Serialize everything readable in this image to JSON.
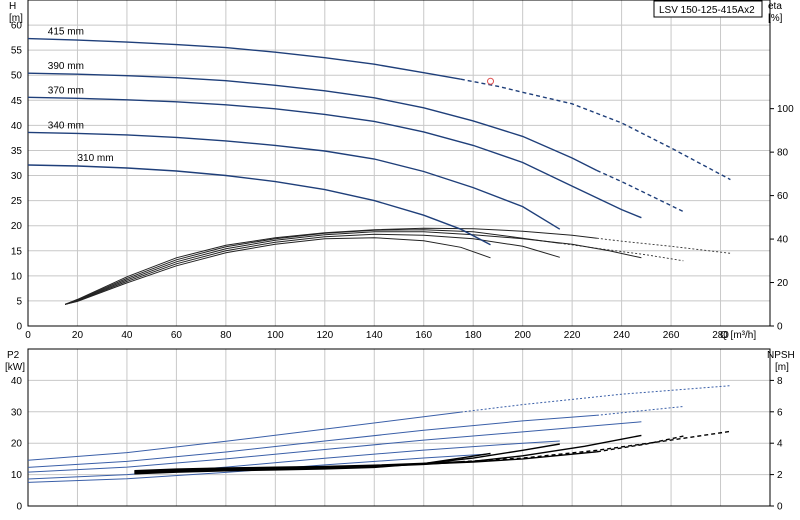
{
  "model": "LSV 150-125-415Ax2",
  "chart_data": [
    {
      "type": "line",
      "x_label": "Q [m³/h]",
      "y_label_left_1": "H",
      "y_label_left_2": "[m]",
      "y_label_right_1": "eta",
      "y_label_right_2": "[%]",
      "xlim": [
        0,
        300
      ],
      "ylim_left": [
        0,
        65
      ],
      "ylim_right": [
        0,
        150
      ],
      "x_ticks": [
        0,
        20,
        40,
        60,
        80,
        100,
        120,
        140,
        160,
        180,
        200,
        220,
        240,
        260,
        280
      ],
      "y_ticks_left": [
        0,
        5,
        10,
        15,
        20,
        25,
        30,
        35,
        40,
        45,
        50,
        55,
        60
      ],
      "y_ticks_right": [
        0,
        20,
        40,
        60,
        80,
        100
      ],
      "x_tick_labels": [
        "0",
        "20",
        "40",
        "60",
        "80",
        "100",
        "120",
        "140",
        "160",
        "180",
        "200",
        "220",
        "240",
        "260",
        "280"
      ],
      "y_tick_labels_left": [
        "0",
        "5",
        "10",
        "15",
        "20",
        "25",
        "30",
        "35",
        "40",
        "45",
        "50",
        "55",
        "60"
      ],
      "y_tick_labels_right": [
        "0",
        "20",
        "40",
        "60",
        "80",
        "100"
      ],
      "duty_point": {
        "q": 187,
        "h": 48.8
      },
      "head_curves": [
        {
          "name": "415 mm",
          "solid": [
            [
              0,
              57.3
            ],
            [
              20,
              57.0
            ],
            [
              40,
              56.6
            ],
            [
              60,
              56.1
            ],
            [
              80,
              55.5
            ],
            [
              100,
              54.6
            ],
            [
              120,
              53.5
            ],
            [
              140,
              52.2
            ],
            [
              160,
              50.5
            ],
            [
              175,
              49.2
            ]
          ],
          "dashed": [
            [
              175,
              49.2
            ],
            [
              190,
              47.8
            ],
            [
              200,
              46.6
            ],
            [
              220,
              44.3
            ],
            [
              240,
              40.5
            ],
            [
              260,
              35.5
            ],
            [
              284,
              29.2
            ]
          ]
        },
        {
          "name": "390 mm",
          "solid": [
            [
              0,
              50.4
            ],
            [
              20,
              50.2
            ],
            [
              40,
              49.9
            ],
            [
              60,
              49.5
            ],
            [
              80,
              48.9
            ],
            [
              100,
              48.0
            ],
            [
              120,
              46.9
            ],
            [
              140,
              45.5
            ],
            [
              160,
              43.5
            ],
            [
              180,
              40.9
            ],
            [
              200,
              37.8
            ],
            [
              220,
              33.5
            ],
            [
              230,
              31.0
            ]
          ],
          "dashed": [
            [
              230,
              31.0
            ],
            [
              240,
              28.8
            ],
            [
              255,
              25.2
            ],
            [
              265,
              22.8
            ]
          ]
        },
        {
          "name": "370 mm",
          "solid": [
            [
              0,
              45.6
            ],
            [
              20,
              45.4
            ],
            [
              40,
              45.1
            ],
            [
              60,
              44.7
            ],
            [
              80,
              44.1
            ],
            [
              100,
              43.3
            ],
            [
              120,
              42.2
            ],
            [
              140,
              40.8
            ],
            [
              160,
              38.7
            ],
            [
              180,
              36.0
            ],
            [
              200,
              32.6
            ],
            [
              220,
              27.9
            ],
            [
              240,
              23.2
            ],
            [
              248,
              21.6
            ]
          ],
          "dashed": []
        },
        {
          "name": "340 mm",
          "solid": [
            [
              0,
              38.6
            ],
            [
              20,
              38.4
            ],
            [
              40,
              38.1
            ],
            [
              60,
              37.6
            ],
            [
              80,
              36.9
            ],
            [
              100,
              36.0
            ],
            [
              120,
              34.9
            ],
            [
              140,
              33.3
            ],
            [
              160,
              30.8
            ],
            [
              180,
              27.6
            ],
            [
              200,
              23.8
            ],
            [
              215,
              19.3
            ]
          ],
          "dashed": []
        },
        {
          "name": "310 mm",
          "solid": [
            [
              0,
              32.1
            ],
            [
              20,
              31.9
            ],
            [
              40,
              31.5
            ],
            [
              60,
              30.9
            ],
            [
              80,
              30.0
            ],
            [
              100,
              28.8
            ],
            [
              120,
              27.2
            ],
            [
              140,
              25.0
            ],
            [
              160,
              22.1
            ],
            [
              175,
              19.3
            ],
            [
              187,
              16.2
            ]
          ],
          "dashed": []
        }
      ],
      "eta_curves": [
        {
          "solid": [
            [
              15,
              4.3
            ],
            [
              20,
              5.3
            ],
            [
              40,
              9.8
            ],
            [
              60,
              13.6
            ],
            [
              80,
              16.1
            ],
            [
              100,
              17.6
            ],
            [
              120,
              18.6
            ],
            [
              140,
              19.2
            ],
            [
              160,
              19.5
            ],
            [
              180,
              19.4
            ],
            [
              200,
              18.9
            ],
            [
              220,
              18.1
            ],
            [
              230,
              17.5
            ]
          ],
          "dashed": [
            [
              230,
              17.5
            ],
            [
              240,
              16.9
            ],
            [
              260,
              15.9
            ],
            [
              284,
              14.5
            ]
          ]
        },
        {
          "solid": [
            [
              15,
              4.3
            ],
            [
              20,
              5.2
            ],
            [
              40,
              9.5
            ],
            [
              60,
              13.2
            ],
            [
              80,
              15.8
            ],
            [
              100,
              17.4
            ],
            [
              120,
              18.5
            ],
            [
              140,
              19.1
            ],
            [
              160,
              19.2
            ],
            [
              180,
              18.8
            ],
            [
              200,
              17.5
            ],
            [
              215,
              16.5
            ]
          ],
          "dashed": [
            [
              215,
              16.5
            ],
            [
              230,
              15.5
            ],
            [
              250,
              14.2
            ],
            [
              265,
              13.0
            ]
          ]
        },
        {
          "solid": [
            [
              15,
              4.3
            ],
            [
              20,
              5.1
            ],
            [
              40,
              9.2
            ],
            [
              60,
              12.8
            ],
            [
              80,
              15.4
            ],
            [
              100,
              17.1
            ],
            [
              120,
              18.2
            ],
            [
              140,
              18.8
            ],
            [
              160,
              18.8
            ],
            [
              180,
              18.2
            ],
            [
              200,
              17.4
            ],
            [
              220,
              16.3
            ],
            [
              235,
              15.0
            ],
            [
              248,
              13.6
            ]
          ],
          "dashed": []
        },
        {
          "solid": [
            [
              15,
              4.3
            ],
            [
              20,
              5.0
            ],
            [
              40,
              8.9
            ],
            [
              60,
              12.4
            ],
            [
              80,
              15.0
            ],
            [
              100,
              16.7
            ],
            [
              120,
              17.8
            ],
            [
              140,
              18.3
            ],
            [
              160,
              18.1
            ],
            [
              180,
              17.4
            ],
            [
              200,
              15.9
            ],
            [
              215,
              13.7
            ]
          ],
          "dashed": []
        },
        {
          "solid": [
            [
              15,
              4.3
            ],
            [
              20,
              4.9
            ],
            [
              40,
              8.6
            ],
            [
              60,
              12.0
            ],
            [
              80,
              14.6
            ],
            [
              100,
              16.3
            ],
            [
              120,
              17.4
            ],
            [
              140,
              17.6
            ],
            [
              160,
              17.0
            ],
            [
              175,
              15.7
            ],
            [
              187,
              13.6
            ]
          ],
          "dashed": []
        }
      ]
    },
    {
      "type": "line",
      "y_label_left_1": "P2",
      "y_label_left_2": "[kW]",
      "y_label_right_1": "NPSH",
      "y_label_right_2": "[m]",
      "xlim": [
        0,
        300
      ],
      "ylim_left": [
        0,
        50
      ],
      "ylim_right": [
        0,
        10
      ],
      "y_ticks_left": [
        0,
        10,
        20,
        30,
        40
      ],
      "y_ticks_right": [
        0,
        2,
        4,
        6,
        8
      ],
      "y_tick_labels_left": [
        "0",
        "10",
        "20",
        "30",
        "40"
      ],
      "y_tick_labels_right": [
        "0",
        "2",
        "4",
        "6",
        "8"
      ],
      "power_curves": [
        {
          "solid": [
            [
              0,
              14.6
            ],
            [
              40,
              17.0
            ],
            [
              80,
              20.6
            ],
            [
              120,
              24.5
            ],
            [
              160,
              28.4
            ],
            [
              175,
              29.9
            ]
          ],
          "dashed": [
            [
              175,
              29.9
            ],
            [
              200,
              32.3
            ],
            [
              240,
              35.6
            ],
            [
              284,
              38.3
            ]
          ]
        },
        {
          "solid": [
            [
              0,
              12.3
            ],
            [
              40,
              14.2
            ],
            [
              80,
              17.2
            ],
            [
              120,
              20.7
            ],
            [
              160,
              24.1
            ],
            [
              200,
              27.1
            ],
            [
              230,
              28.9
            ]
          ],
          "dashed": [
            [
              230,
              28.9
            ],
            [
              265,
              31.7
            ]
          ]
        },
        {
          "solid": [
            [
              0,
              10.8
            ],
            [
              40,
              12.4
            ],
            [
              80,
              15.0
            ],
            [
              120,
              18.0
            ],
            [
              160,
              21.0
            ],
            [
              200,
              23.6
            ],
            [
              248,
              26.8
            ]
          ],
          "dashed": []
        },
        {
          "solid": [
            [
              0,
              8.6
            ],
            [
              40,
              10.0
            ],
            [
              80,
              12.4
            ],
            [
              120,
              15.2
            ],
            [
              160,
              17.8
            ],
            [
              200,
              20.0
            ],
            [
              215,
              20.7
            ]
          ],
          "dashed": []
        },
        {
          "solid": [
            [
              0,
              7.5
            ],
            [
              40,
              8.7
            ],
            [
              80,
              10.7
            ],
            [
              120,
              13.1
            ],
            [
              160,
              15.3
            ],
            [
              187,
              16.6
            ]
          ],
          "dashed": []
        }
      ],
      "npsh_curves": [
        {
          "solid": [
            [
              43,
              2.25
            ],
            [
              60,
              2.35
            ],
            [
              80,
              2.42
            ],
            [
              100,
              2.47
            ],
            [
              120,
              2.52
            ],
            [
              140,
              2.6
            ],
            [
              160,
              2.72
            ],
            [
              175,
              2.82
            ]
          ],
          "dashed": [
            [
              175,
              2.82
            ],
            [
              200,
              3.05
            ],
            [
              230,
              3.55
            ],
            [
              260,
              4.2
            ],
            [
              284,
              4.75
            ]
          ]
        },
        {
          "solid": [
            [
              43,
              2.2
            ],
            [
              60,
              2.3
            ],
            [
              80,
              2.38
            ],
            [
              100,
              2.43
            ],
            [
              120,
              2.48
            ],
            [
              140,
              2.55
            ],
            [
              160,
              2.67
            ],
            [
              180,
              2.8
            ],
            [
              200,
              3.0
            ],
            [
              230,
              3.45
            ]
          ],
          "dashed": [
            [
              230,
              3.45
            ],
            [
              250,
              3.95
            ],
            [
              265,
              4.45
            ]
          ]
        },
        {
          "solid": [
            [
              43,
              2.15
            ],
            [
              60,
              2.25
            ],
            [
              80,
              2.33
            ],
            [
              100,
              2.38
            ],
            [
              120,
              2.44
            ],
            [
              140,
              2.52
            ],
            [
              160,
              2.65
            ],
            [
              180,
              2.85
            ],
            [
              200,
              3.2
            ],
            [
              225,
              3.8
            ],
            [
              248,
              4.5
            ]
          ],
          "dashed": []
        },
        {
          "solid": [
            [
              43,
              2.1
            ],
            [
              60,
              2.2
            ],
            [
              80,
              2.28
            ],
            [
              100,
              2.34
            ],
            [
              120,
              2.4
            ],
            [
              140,
              2.5
            ],
            [
              160,
              2.7
            ],
            [
              180,
              3.05
            ],
            [
              200,
              3.55
            ],
            [
              215,
              3.95
            ]
          ],
          "dashed": []
        },
        {
          "solid": [
            [
              43,
              2.05
            ],
            [
              60,
              2.15
            ],
            [
              80,
              2.24
            ],
            [
              100,
              2.3
            ],
            [
              120,
              2.36
            ],
            [
              140,
              2.46
            ],
            [
              160,
              2.7
            ],
            [
              175,
              3.05
            ],
            [
              187,
              3.35
            ]
          ],
          "dashed": []
        }
      ]
    }
  ]
}
